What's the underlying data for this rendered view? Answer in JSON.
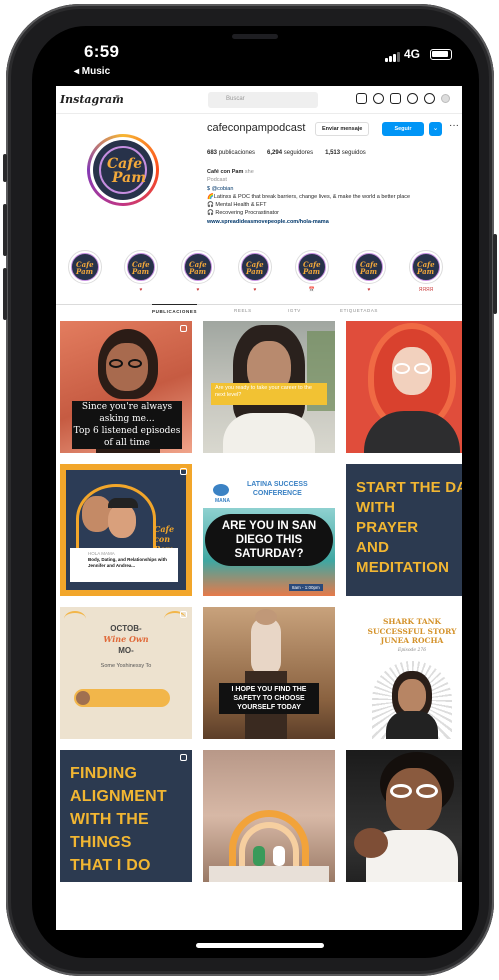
{
  "status": {
    "time": "6:59",
    "back_label": "◂ Music",
    "network": "4G"
  },
  "topbar": {
    "logo": "Instagram",
    "search_placeholder": "Buscar",
    "icons": [
      "home-icon",
      "messenger-icon",
      "new-post-icon",
      "explore-icon",
      "heart-icon",
      "profile-icon"
    ]
  },
  "profile": {
    "username": "cafeconpampodcast",
    "message_button": "Enviar mensaje",
    "follow_button": "Seguir",
    "more_button": "⌄",
    "stats": {
      "posts": "683",
      "posts_label": "publicaciones",
      "followers": "6,294",
      "followers_label": "seguidores",
      "following": "1,513",
      "following_label": "seguidos"
    },
    "bio": {
      "name": "Café con Pam",
      "pronoun": "she",
      "category": "Podcast",
      "handle": "$ @cobian",
      "line1": "🌈Latinxs & POC that break barriers, change lives, & make the world a better place",
      "line2": "🎧 Mental Health & EFT",
      "line3": "🎧 Recovering Procrastinator",
      "link": "www.spreadideasmovepeople.com/hola-mama"
    },
    "avatar_text_1": "Cafe",
    "avatar_text_2": "Pam"
  },
  "highlights": [
    {
      "label": ""
    },
    {
      "label": "♥"
    },
    {
      "label": "♥"
    },
    {
      "label": "♥"
    },
    {
      "label": "📅"
    },
    {
      "label": "♥"
    },
    {
      "label": "ЯЯЯЯ"
    }
  ],
  "tabs": [
    "PUBLICACIONES",
    "REELS",
    "IGTV",
    "ETIQUETADAS"
  ],
  "posts": {
    "p1": {
      "caption_1": "Since you're always",
      "caption_2": "asking me...",
      "caption_3": "Top 6 listened episodes",
      "caption_4": "of all time"
    },
    "p2": {
      "caption": "Are you ready to take your career to the next level?"
    },
    "p4": {
      "badge": "HOLA MAMA",
      "title": "Body, Dating, and Relationships with Jennifer and Andrea..."
    },
    "p5": {
      "org": "MANA",
      "conf_1": "LATINA SUCCESS",
      "conf_2": "CONFERENCE",
      "line1": "ARE YOU IN SAN",
      "line2": "DIEGO THIS",
      "line3": "SATURDAY?",
      "footer": "8am - 1:00pm"
    },
    "p6": {
      "l1": "START THE DAY",
      "l2": "WITH",
      "l3": "PRAYER",
      "l4": "AND",
      "l5": "MEDITATION"
    },
    "p7": {
      "l1": "OCTOB-",
      "l2": "Wine Own",
      "l3": "MO-",
      "l4": "Some Yoshinessy To"
    },
    "p8": {
      "l1": "I HOPE YOU FIND THE",
      "l2": "SAFETY TO CHOOSE",
      "l3": "YOURSELF TODAY"
    },
    "p9": {
      "l1": "SHARK TANK",
      "l2": "SUCCESSFUL STORY",
      "l3": "JUNEA ROCHA",
      "l4": "Episode 276"
    },
    "p10": {
      "l1": "FINDING",
      "l2": "ALIGNMENT",
      "l3": "WITH THE",
      "l4": "THINGS",
      "l5": "THAT I DO"
    }
  }
}
